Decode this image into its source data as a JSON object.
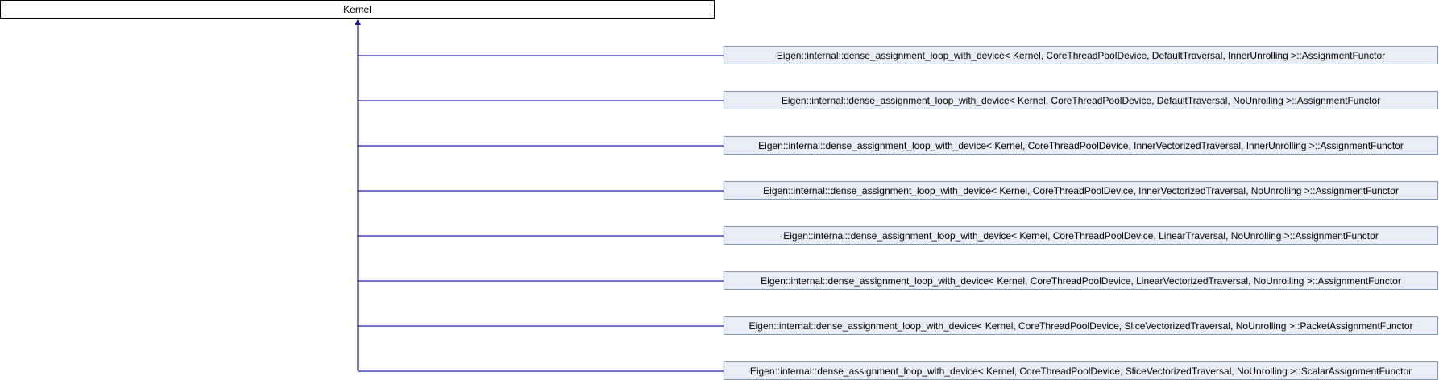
{
  "base_class": {
    "label": "Kernel"
  },
  "derived_classes": [
    "Eigen::internal::dense_assignment_loop_with_device< Kernel, CoreThreadPoolDevice, DefaultTraversal, InnerUnrolling >::AssignmentFunctor",
    "Eigen::internal::dense_assignment_loop_with_device< Kernel, CoreThreadPoolDevice, DefaultTraversal, NoUnrolling >::AssignmentFunctor",
    "Eigen::internal::dense_assignment_loop_with_device< Kernel, CoreThreadPoolDevice, InnerVectorizedTraversal, InnerUnrolling >::AssignmentFunctor",
    "Eigen::internal::dense_assignment_loop_with_device< Kernel, CoreThreadPoolDevice, InnerVectorizedTraversal, NoUnrolling >::AssignmentFunctor",
    "Eigen::internal::dense_assignment_loop_with_device< Kernel, CoreThreadPoolDevice, LinearTraversal, NoUnrolling >::AssignmentFunctor",
    "Eigen::internal::dense_assignment_loop_with_device< Kernel, CoreThreadPoolDevice, LinearVectorizedTraversal, NoUnrolling >::AssignmentFunctor",
    "Eigen::internal::dense_assignment_loop_with_device< Kernel, CoreThreadPoolDevice, SliceVectorizedTraversal, NoUnrolling >::PacketAssignmentFunctor",
    "Eigen::internal::dense_assignment_loop_with_device< Kernel, CoreThreadPoolDevice, SliceVectorizedTraversal, NoUnrolling >::ScalarAssignmentFunctor"
  ],
  "colors": {
    "edge": "#1a1aa6",
    "derived_fill": "#e8eef7",
    "derived_border": "#8497b5",
    "base_border": "#000000"
  }
}
